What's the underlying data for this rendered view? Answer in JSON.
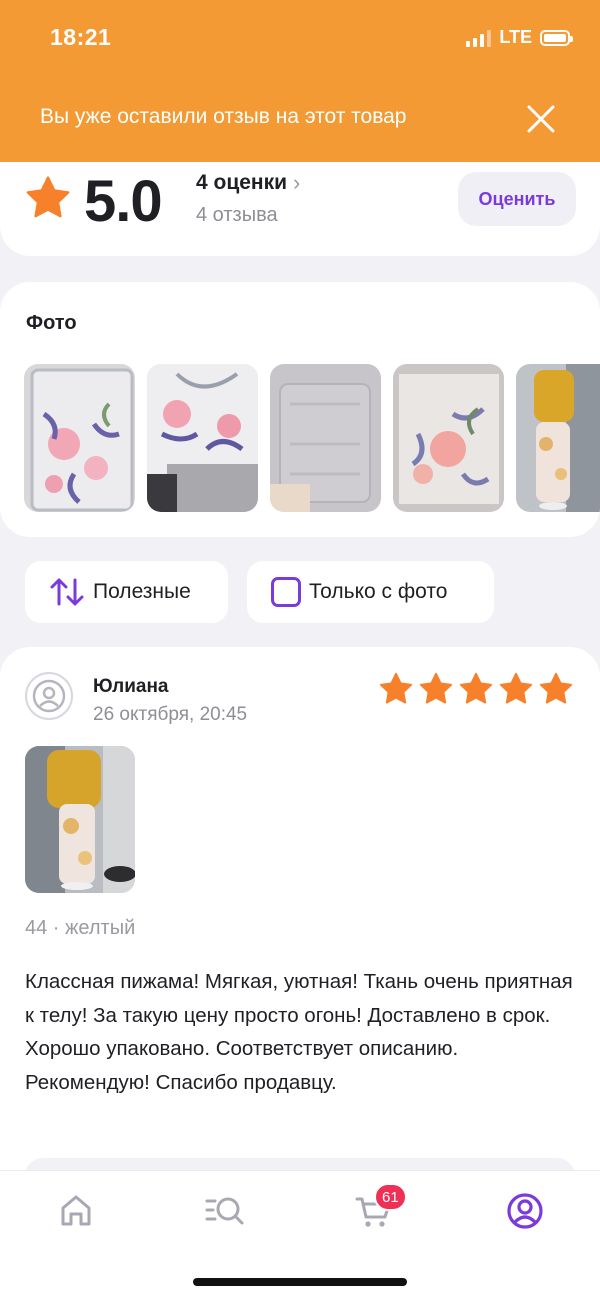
{
  "status_bar": {
    "time": "18:21",
    "network": "LTE"
  },
  "notice": {
    "text": "Вы уже оставили отзыв на этот товар"
  },
  "rating": {
    "value": "5.0",
    "ratings_count_label": "4 оценки",
    "reviews_count_label": "4 отзыва",
    "rate_button_label": "Оценить"
  },
  "photos": {
    "title": "Фото"
  },
  "filters": {
    "useful_label": "Полезные",
    "photo_only_label": "Только с фото"
  },
  "review": {
    "author": "Юлиана",
    "date": "26 октября, 20:45",
    "stars": 5,
    "variant": "44 · желтый",
    "text": "Классная пижама! Мягкая,  уютная! Ткань очень приятная к телу! За такую цену  просто  огонь! Доставлено в срок. Хорошо упаковано. Соответствует описанию. Рекомендую! Спасибо продавцу."
  },
  "tab_bar": {
    "cart_badge": "61"
  },
  "colors": {
    "accent_orange": "#f49a34",
    "accent_purple": "#7b3bdb",
    "star": "#f7802a",
    "badge": "#ef2f55"
  }
}
